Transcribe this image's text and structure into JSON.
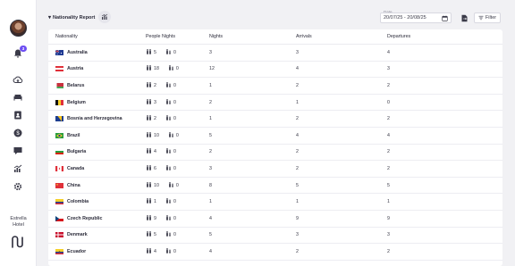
{
  "hotel": {
    "name_line1": "Estrella",
    "name_line2": "Hotel"
  },
  "notifications": {
    "count": "3"
  },
  "header": {
    "title": "Nationality Report",
    "date_label": "Date",
    "date_range": "20/07/25 - 20/08/25",
    "filter_label": "Filter"
  },
  "table": {
    "columns": [
      "Nationality",
      "People Nights",
      "Nights",
      "Arrivals",
      "Departures"
    ],
    "rows": [
      {
        "country": "Australia",
        "adults": "5",
        "children": "0",
        "nights": "3",
        "arrivals": "3",
        "departures": "4"
      },
      {
        "country": "Austria",
        "adults": "18",
        "children": "0",
        "nights": "12",
        "arrivals": "4",
        "departures": "3"
      },
      {
        "country": "Belarus",
        "adults": "2",
        "children": "0",
        "nights": "1",
        "arrivals": "2",
        "departures": "2"
      },
      {
        "country": "Belgium",
        "adults": "3",
        "children": "0",
        "nights": "2",
        "arrivals": "1",
        "departures": "0"
      },
      {
        "country": "Bosnia and Herzegovina",
        "adults": "2",
        "children": "0",
        "nights": "1",
        "arrivals": "2",
        "departures": "2"
      },
      {
        "country": "Brazil",
        "adults": "10",
        "children": "0",
        "nights": "5",
        "arrivals": "4",
        "departures": "4"
      },
      {
        "country": "Bulgaria",
        "adults": "4",
        "children": "0",
        "nights": "2",
        "arrivals": "2",
        "departures": "2"
      },
      {
        "country": "Canada",
        "adults": "6",
        "children": "0",
        "nights": "3",
        "arrivals": "2",
        "departures": "2"
      },
      {
        "country": "China",
        "adults": "10",
        "children": "0",
        "nights": "8",
        "arrivals": "5",
        "departures": "5"
      },
      {
        "country": "Colombia",
        "adults": "1",
        "children": "0",
        "nights": "1",
        "arrivals": "1",
        "departures": "1"
      },
      {
        "country": "Czech Republic",
        "adults": "9",
        "children": "0",
        "nights": "4",
        "arrivals": "9",
        "departures": "9"
      },
      {
        "country": "Denmark",
        "adults": "5",
        "children": "0",
        "nights": "5",
        "arrivals": "3",
        "departures": "3"
      },
      {
        "country": "Ecuador",
        "adults": "4",
        "children": "0",
        "nights": "4",
        "arrivals": "2",
        "departures": "2"
      }
    ]
  },
  "icons": {
    "nav": [
      "bell-icon",
      "cloud-icon",
      "bed-icon",
      "contacts-icon",
      "dollar-icon",
      "chat-icon",
      "chart-icon",
      "gear-icon"
    ],
    "adults": "adults-icon",
    "children": "children-icon"
  },
  "colors": {
    "accent": "#6d4ef2",
    "sidebar_bg": "#ffffff",
    "page_bg": "#f1f1f4"
  }
}
